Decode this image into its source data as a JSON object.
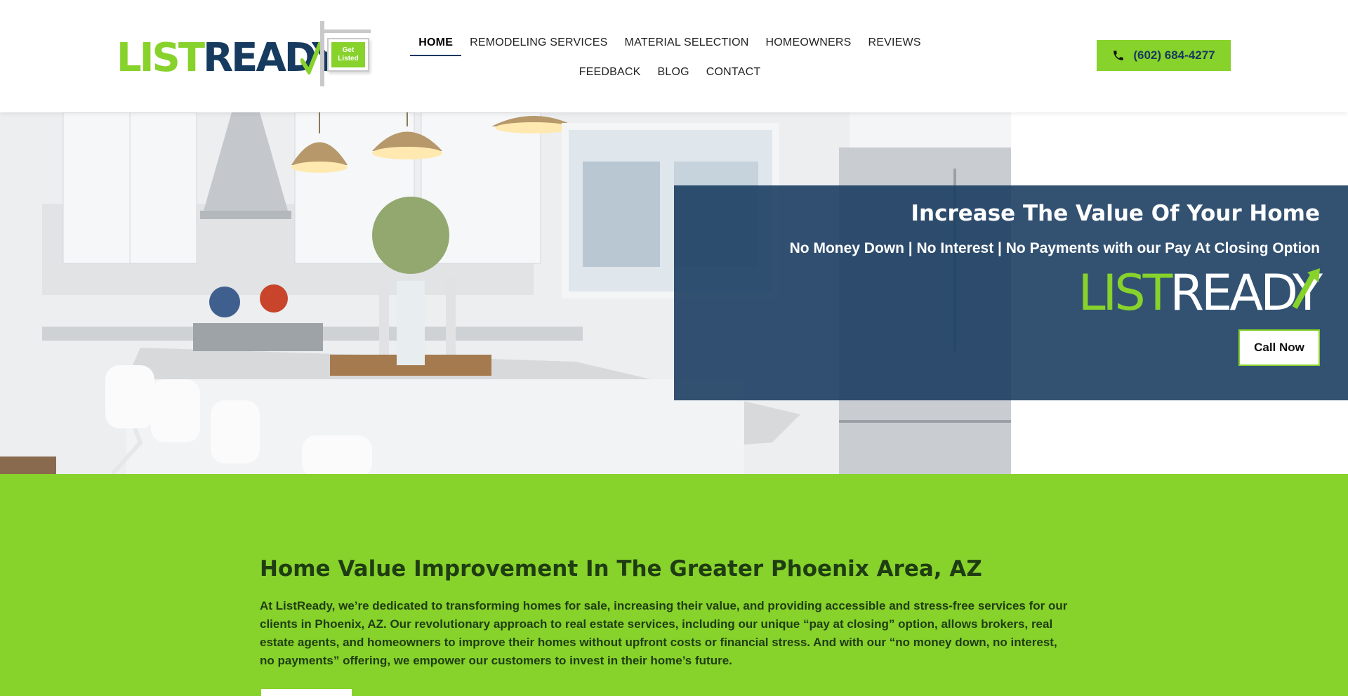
{
  "header": {
    "logo": {
      "list": "LIST",
      "ready": "READY",
      "sign_line1": "Get",
      "sign_line2": "Listed"
    },
    "nav_row1": [
      "HOME",
      "REMODELING SERVICES",
      "MATERIAL SELECTION",
      "HOMEOWNERS",
      "REVIEWS"
    ],
    "nav_row2": [
      "FEEDBACK",
      "BLOG",
      "CONTACT"
    ],
    "active_nav": "HOME",
    "phone": {
      "icon": "phone-icon",
      "label": "(602) 684-4277"
    }
  },
  "hero": {
    "title": "Increase The Value Of Your Home",
    "subtitle": "No Money Down | No Interest | No Payments with our Pay At Closing Option",
    "logo": {
      "list": "LIST",
      "ready": "READY"
    },
    "cta": "Call Now",
    "image": "kitchen-interior-photo"
  },
  "intro": {
    "title": "Home Value Improvement In The Greater Phoenix Area, AZ",
    "text": "At ListReady, we’re dedicated to transforming homes for sale, increasing their value, and providing accessible and stress-free services for our clients in Phoenix, AZ. Our revolutionary approach to real estate services, including our unique “pay at closing” option, allows brokers, real estate agents, and homeowners to improve their homes without upfront costs or financial stress. And with our “no money down, no interest, no payments” offering, we empower our customers to invest in their home’s future."
  },
  "colors": {
    "brand_green": "#87d22b",
    "brand_navy": "#173a5f",
    "dark_green_text": "#1f3d12"
  }
}
